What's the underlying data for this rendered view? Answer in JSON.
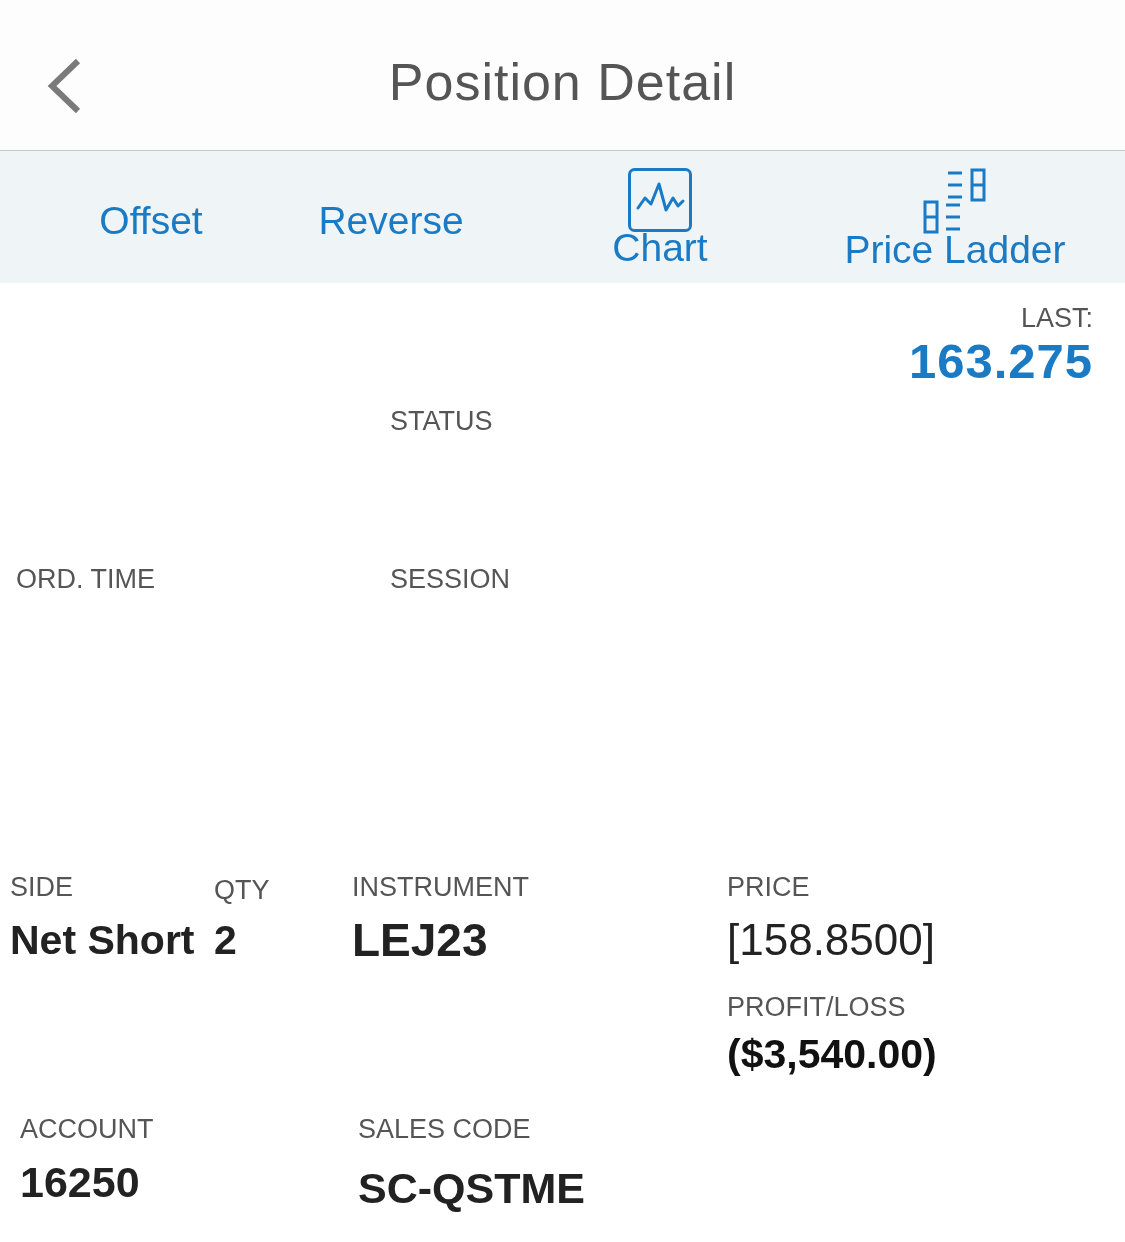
{
  "header": {
    "title": "Position Detail"
  },
  "toolbar": {
    "actions": [
      {
        "label": "Offset",
        "kind": "text"
      },
      {
        "label": "Reverse",
        "kind": "text"
      },
      {
        "label": "Chart",
        "kind": "chart"
      },
      {
        "label": "Price Ladder",
        "kind": "ladder"
      }
    ]
  },
  "last": {
    "label": "LAST:",
    "value": "163.275"
  },
  "status": {
    "label": "STATUS"
  },
  "order": [
    {
      "label": "ORD. TIME"
    },
    {
      "label": "SESSION"
    }
  ],
  "position": {
    "columns": [
      {
        "label": "SIDE",
        "value": "Net Short"
      },
      {
        "label": "QTY",
        "value": "2"
      },
      {
        "label": "INSTRUMENT",
        "value": "LEJ23"
      },
      {
        "label": "PRICE",
        "value": "[158.8500]"
      }
    ],
    "profit_loss": {
      "label": "PROFIT/LOSS",
      "value": "($3,540.00)"
    }
  },
  "account": [
    {
      "label": "ACCOUNT",
      "value": "16250"
    },
    {
      "label": "SALES CODE",
      "value": "SC-QSTME"
    }
  ]
}
